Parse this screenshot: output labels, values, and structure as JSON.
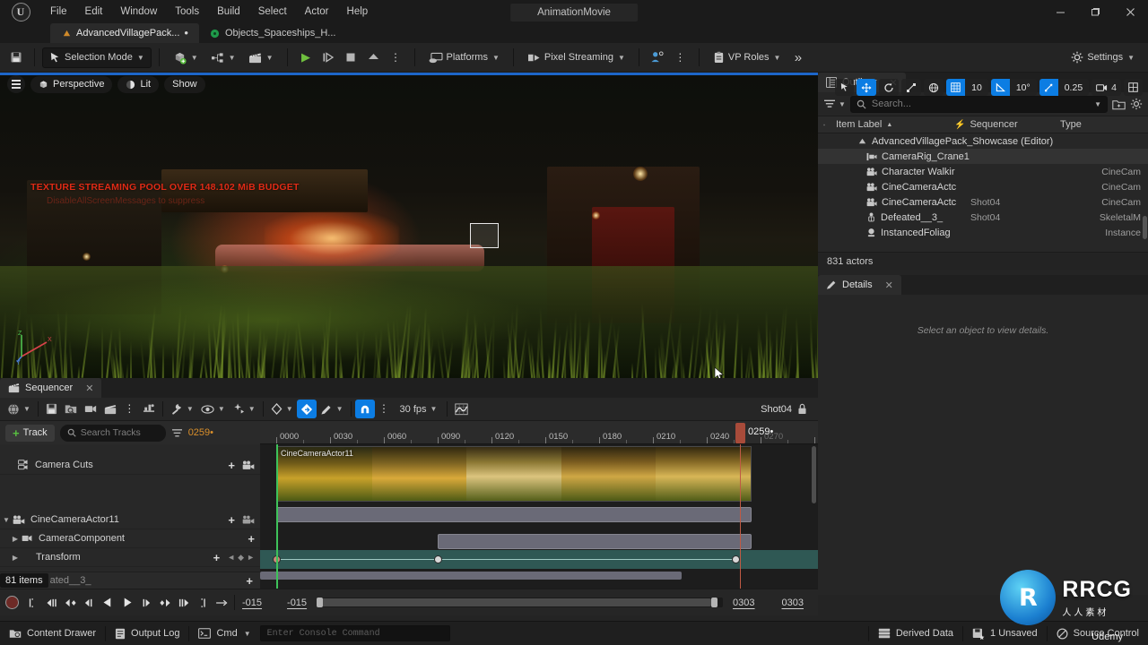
{
  "window": {
    "title": "AnimationMovie",
    "minimize_label": "–",
    "maximize_label": "❐",
    "close_label": "✕"
  },
  "menubar": {
    "items": [
      "File",
      "Edit",
      "Window",
      "Tools",
      "Build",
      "Select",
      "Actor",
      "Help"
    ]
  },
  "tabs": [
    {
      "label": "AdvancedVillagePack...",
      "modified": "•",
      "icon": "level-icon",
      "active": true
    },
    {
      "label": "Objects_Spaceships_H...",
      "modified": "",
      "icon": "blueprint-icon",
      "active": false
    }
  ],
  "toolbar": {
    "save_label": "",
    "mode_label": "Selection Mode",
    "platforms_label": "Platforms",
    "pixel_streaming_label": "Pixel Streaming",
    "vp_roles_label": "VP Roles",
    "settings_label": "Settings",
    "overflow_label": "≫"
  },
  "viewport": {
    "view_mode_label": "Perspective",
    "lighting_label": "Lit",
    "show_label": "Show",
    "warning_line1": "TEXTURE STREAMING POOL OVER 148.102 MiB BUDGET",
    "warning_line2": "DisableAllScreenMessages to suppress",
    "grid_snap_value": "10",
    "angle_snap_value": "10°",
    "scale_snap_value": "0.25",
    "camera_speed_value": "4",
    "axis_x": "X",
    "axis_y": "Y",
    "axis_z": "Z"
  },
  "outliner": {
    "tab_label": "Outliner",
    "close_label": "✕",
    "search_placeholder": "Search...",
    "columns": [
      "Item Label",
      "Sequencer",
      "Type"
    ],
    "sort_indicator": "▲",
    "rows": [
      {
        "name": "AdvancedVillagePack_Showcase (Editor)",
        "sequencer": "",
        "type": "",
        "icon": "level-icon",
        "indent": 0,
        "highlight": false
      },
      {
        "name": "CameraRig_Crane1",
        "sequencer": "",
        "type": "",
        "icon": "camera-rig-icon",
        "indent": 1,
        "highlight": true
      },
      {
        "name": "Character Walkir",
        "sequencer": "",
        "type": "CineCam",
        "icon": "cine-camera-icon",
        "indent": 1,
        "highlight": false
      },
      {
        "name": "CineCameraActc",
        "sequencer": "",
        "type": "CineCam",
        "icon": "cine-camera-icon",
        "indent": 1,
        "highlight": false
      },
      {
        "name": "CineCameraActc",
        "sequencer": "Shot04",
        "type": "CineCam",
        "icon": "cine-camera-icon",
        "indent": 1,
        "highlight": false
      },
      {
        "name": "Defeated__3_",
        "sequencer": "Shot04",
        "type": "SkeletalM",
        "icon": "skeletal-mesh-icon",
        "indent": 1,
        "highlight": false
      },
      {
        "name": "InstancedFoliag",
        "sequencer": "",
        "type": "Instance",
        "icon": "foliage-icon",
        "indent": 1,
        "highlight": false
      }
    ],
    "actor_count": "831 actors"
  },
  "details": {
    "tab_label": "Details",
    "close_label": "✕",
    "empty_message": "Select an object to view details."
  },
  "sequencer": {
    "tab_label": "Sequencer",
    "close_label": "✕",
    "fps_label": "30 fps",
    "shot_label": "Shot04",
    "add_track_label": "Track",
    "add_track_plus": "+",
    "search_placeholder": "Search Tracks",
    "current_frame_label": "0259",
    "current_frame_suffix": "•",
    "playhead_label": "0259",
    "playhead_suffix": "•",
    "ruler_ticks": [
      "0000",
      "0030",
      "0060",
      "0090",
      "0120",
      "0150",
      "0180",
      "0210",
      "0240",
      "0270"
    ],
    "tracks": [
      {
        "label": "Camera Cuts",
        "icon": "camera-cuts-icon",
        "indent": 0,
        "expandable": false,
        "has_plus": true
      },
      {
        "label": "CineCameraActor11",
        "icon": "cine-camera-icon",
        "indent": 0,
        "expandable": true,
        "expanded": true,
        "has_plus": true
      },
      {
        "label": "CameraComponent",
        "icon": "camera-component-icon",
        "indent": 1,
        "expandable": true,
        "expanded": false,
        "has_plus": true
      },
      {
        "label": "Transform",
        "icon": "transform-icon",
        "indent": 1,
        "expandable": true,
        "expanded": false,
        "has_plus": true
      }
    ],
    "item_count": "81 items",
    "item_count_ghost": "ated__3_",
    "camera_cut_label": "CineCameraActor11",
    "range_start": "-015",
    "view_start": "-015",
    "range_end": "0303",
    "view_end": "0303"
  },
  "statusbar": {
    "content_drawer_label": "Content Drawer",
    "output_log_label": "Output Log",
    "cmd_label": "Cmd",
    "console_placeholder": "Enter Console Command",
    "derived_data_label": "Derived Data",
    "unsaved_label": "1 Unsaved",
    "source_control_label": "Source Control"
  },
  "watermark": {
    "logo_letter": "R",
    "brand": "RRCG",
    "sub": "人人素材",
    "overlay": "Udemy"
  },
  "colors": {
    "accent_blue": "#0c7de3",
    "warning_red": "#e02b16",
    "frame_orange": "#d98f2b",
    "play_green": "#6fbf3e",
    "teal_row": "#2f5854"
  }
}
